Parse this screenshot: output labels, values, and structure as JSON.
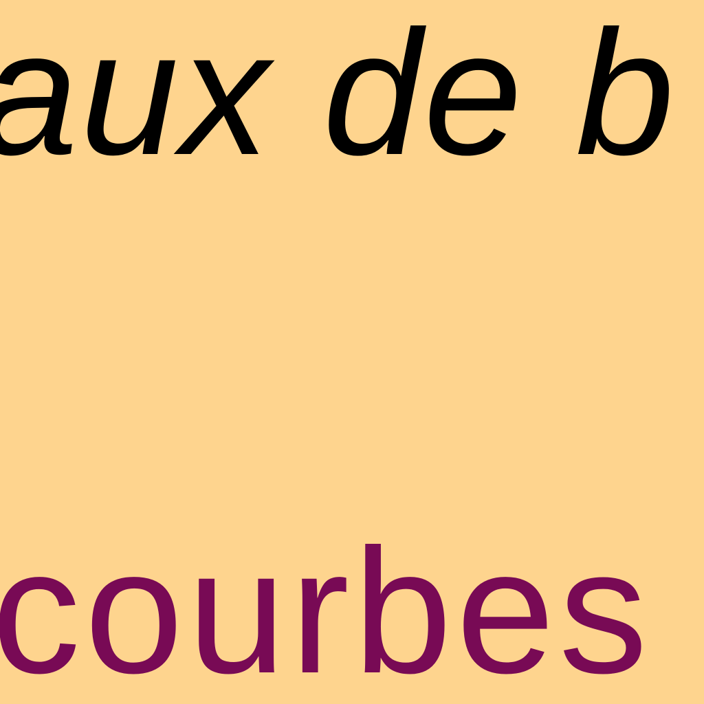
{
  "colors": {
    "background": "#FED48E",
    "heading_text": "#000000",
    "subheading_text": "#780A55"
  },
  "heading": {
    "text": "aux de b"
  },
  "subheading": {
    "text": "courbes"
  }
}
